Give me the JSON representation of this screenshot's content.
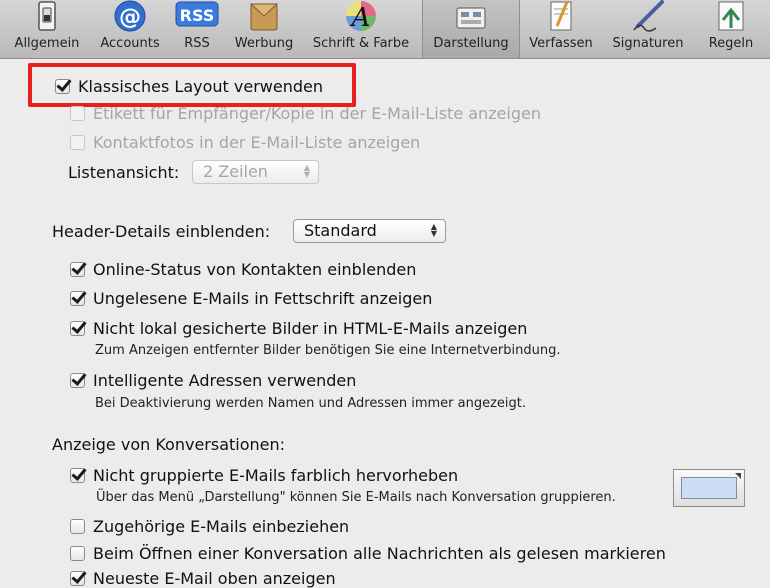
{
  "toolbar": {
    "items": [
      {
        "label": "Allgemein",
        "icon": "switch-icon"
      },
      {
        "label": "Accounts",
        "icon": "at-sign-icon"
      },
      {
        "label": "RSS",
        "icon": "rss-icon",
        "icon_text": "RSS"
      },
      {
        "label": "Werbung",
        "icon": "junk-mail-icon"
      },
      {
        "label": "Schrift & Farbe",
        "icon": "font-color-icon",
        "icon_text": "A"
      },
      {
        "label": "Darstellung",
        "icon": "viewing-icon",
        "selected": true
      },
      {
        "label": "Verfassen",
        "icon": "compose-icon"
      },
      {
        "label": "Signaturen",
        "icon": "signature-pen-icon"
      },
      {
        "label": "Regeln",
        "icon": "rules-icon"
      }
    ]
  },
  "layout_section": {
    "classic_layout": {
      "label": "Klassisches Layout verwenden",
      "checked": true
    },
    "show_to_cc": {
      "label": "Etikett für Empfänger/Kopie in der E-Mail-Liste anzeigen",
      "checked": false,
      "disabled": true
    },
    "show_contact_photos": {
      "label": "Kontaktfotos in der E-Mail-Liste anzeigen",
      "checked": false,
      "disabled": true
    },
    "list_view_label": "Listenansicht:",
    "list_view_value": "2 Zeilen"
  },
  "header_section": {
    "label": "Header-Details einblenden:",
    "value": "Standard",
    "online_status": {
      "label": "Online-Status von Kontakten einblenden",
      "checked": true
    },
    "unread_bold": {
      "label": "Ungelesene E-Mails in Fettschrift anzeigen",
      "checked": true
    },
    "remote_images": {
      "label": "Nicht lokal gesicherte Bilder in HTML-E-Mails anzeigen",
      "checked": true,
      "hint": "Zum Anzeigen entfernter Bilder benötigen Sie eine Internetverbindung."
    },
    "smart_addresses": {
      "label": "Intelligente Adressen verwenden",
      "checked": true,
      "hint": "Bei Deaktivierung werden Namen und Adressen immer angezeigt."
    }
  },
  "conversation_section": {
    "title": "Anzeige von Konversationen:",
    "highlight_ungrouped": {
      "label": "Nicht gruppierte E-Mails farblich hervorheben",
      "checked": true,
      "hint": "Über das Menü „Darstellung\" können Sie E-Mails nach Konversation gruppieren."
    },
    "include_related": {
      "label": "Zugehörige E-Mails einbeziehen",
      "checked": false
    },
    "mark_all_read": {
      "label": "Beim Öffnen einer Konversation alle Nachrichten als gelesen markieren",
      "checked": false
    },
    "newest_on_top": {
      "label": "Neueste E-Mail oben anzeigen",
      "checked": true
    }
  },
  "colors": {
    "highlight_border": "#e8201d",
    "conversation_color": "#cdddf6",
    "toolbar_bg": "#c7c7c7",
    "window_bg": "#ececec"
  }
}
